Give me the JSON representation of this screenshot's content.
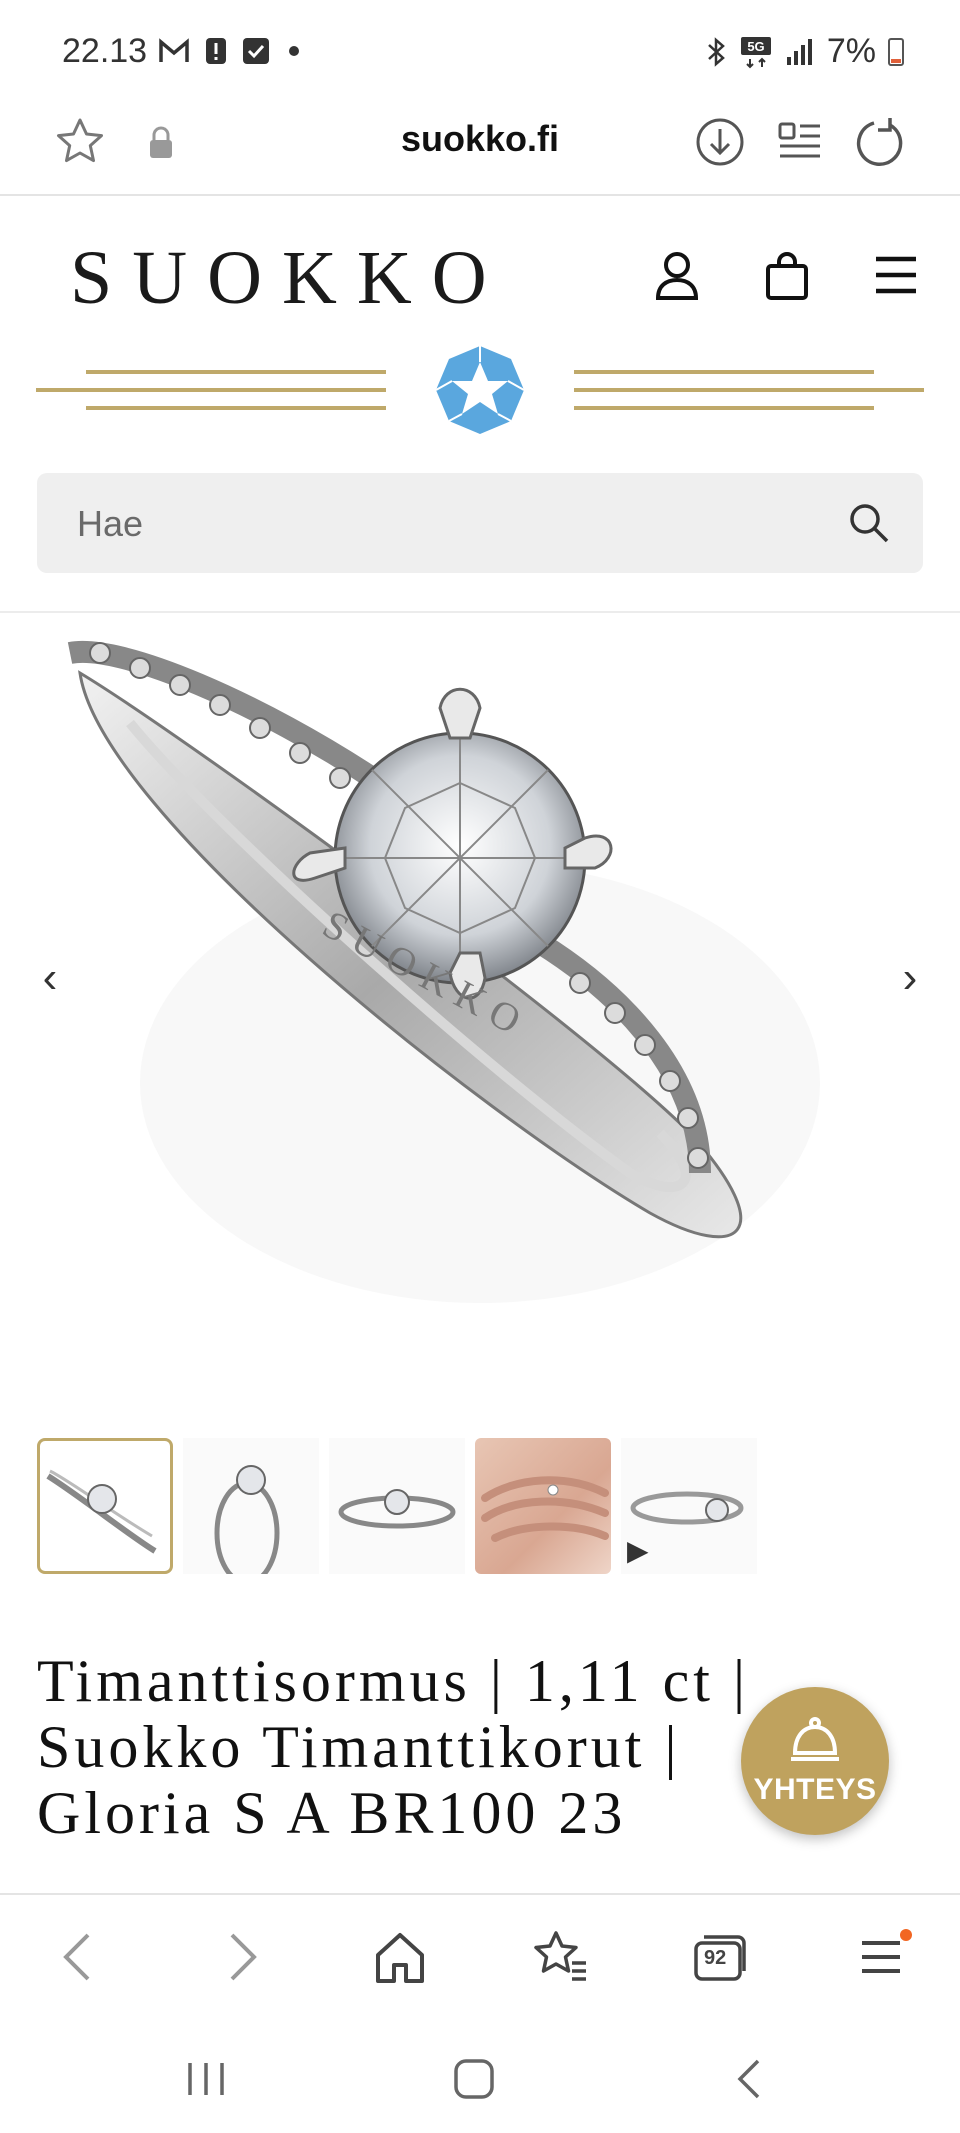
{
  "status_bar": {
    "time": "22.13",
    "battery_text": "7%",
    "left_icons": [
      "gmail-icon",
      "alert-icon",
      "checkbox-icon",
      "dot-icon"
    ],
    "right_icons": [
      "bluetooth-icon",
      "5g-icon",
      "signal-icon",
      "battery-icon"
    ]
  },
  "browser": {
    "url": "suokko.fi",
    "tab_count": "92"
  },
  "site": {
    "logo": "SUOKKO",
    "accent_gold": "#bfa96a",
    "accent_blue": "#5aa7de"
  },
  "search": {
    "placeholder": "Hae"
  },
  "gallery": {
    "prev_label": "‹",
    "next_label": "›",
    "thumbnails": [
      "ring-angle",
      "ring-side",
      "ring-front",
      "ring-on-hand",
      "ring-video"
    ],
    "active_index": 0,
    "play_label": "▶"
  },
  "product": {
    "title": "Timanttisormus | 1,11 ct | Suokko Timanttikorut | Gloria S A BR100 23"
  },
  "contact_button": {
    "label": "YHTEYS"
  }
}
